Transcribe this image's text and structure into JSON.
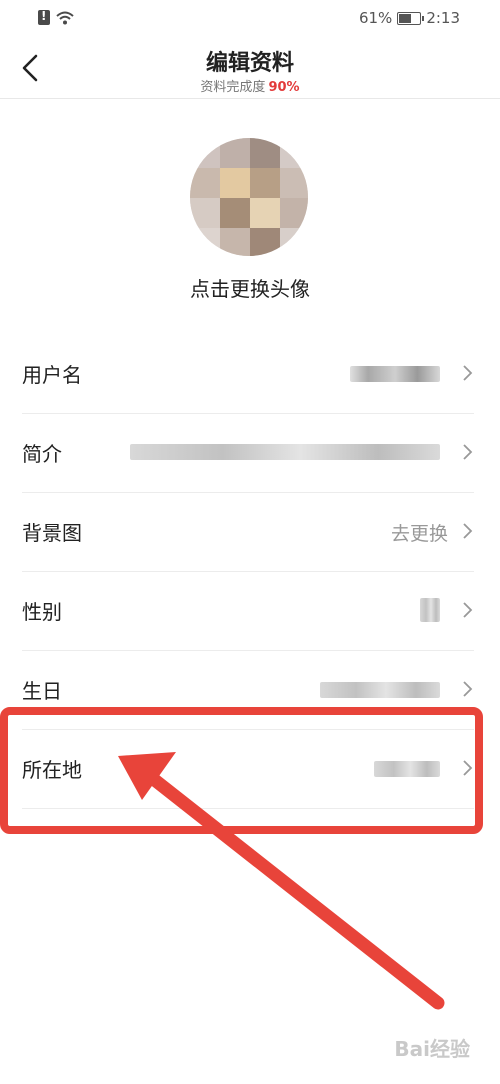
{
  "status_bar": {
    "battery_percent": "61%",
    "time": "2:13",
    "battery_level": 0.61
  },
  "header": {
    "title": "编辑资料",
    "completion_label": "资料完成度",
    "completion_value": "90%"
  },
  "avatar": {
    "caption": "点击更换头像"
  },
  "profile_rows": [
    {
      "label": "用户名",
      "value": ""
    },
    {
      "label": "简介",
      "value": ""
    },
    {
      "label": "背景图",
      "value": "去更换"
    },
    {
      "label": "性别",
      "value": ""
    },
    {
      "label": "生日",
      "value": ""
    },
    {
      "label": "所在地",
      "value": ""
    }
  ],
  "annotation": {
    "color": "#e8443a"
  },
  "watermark": "Bai经验"
}
